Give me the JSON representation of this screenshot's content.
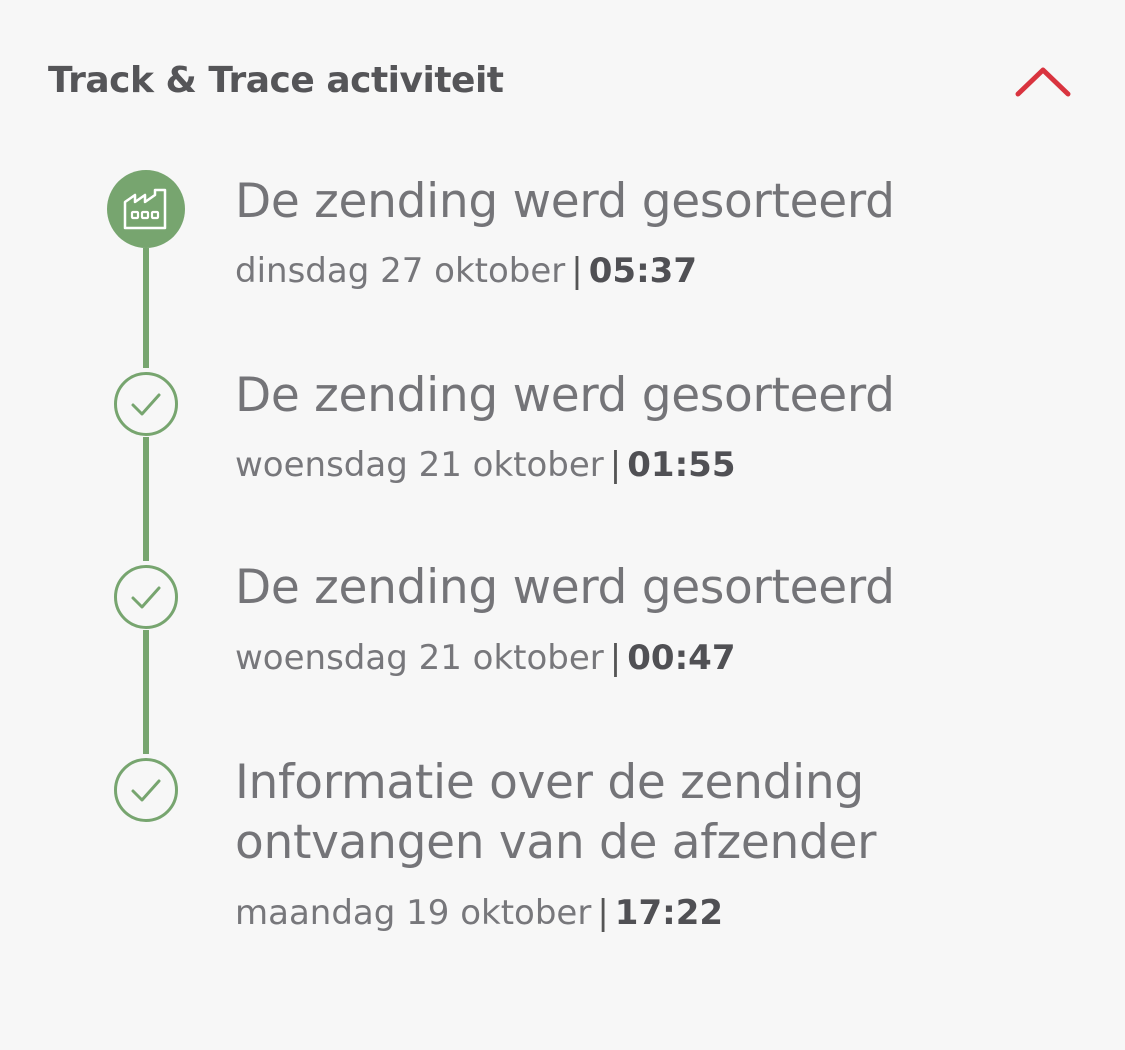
{
  "header": {
    "title": "Track & Trace activiteit",
    "toggle_icon": "chevron-up-icon",
    "accent_color": "#d9343f"
  },
  "timeline": {
    "line_color": "#77a56f",
    "events": [
      {
        "title": "De zending werd gesorteerd",
        "date": "dinsdag 27 oktober",
        "separator": "|",
        "time": "05:37",
        "icon": "factory-icon",
        "current": true
      },
      {
        "title": "De zending werd gesorteerd",
        "date": "woensdag 21 oktober",
        "separator": "|",
        "time": "01:55",
        "icon": "check-circle-icon",
        "current": false
      },
      {
        "title": "De zending werd gesorteerd",
        "date": "woensdag 21 oktober",
        "separator": "|",
        "time": "00:47",
        "icon": "check-circle-icon",
        "current": false
      },
      {
        "title_line1": "Informatie over de zending",
        "title_line2": "ontvangen van de afzender",
        "date": "maandag 19 oktober",
        "separator": "|",
        "time": "17:22",
        "icon": "check-circle-icon",
        "current": false
      }
    ]
  }
}
